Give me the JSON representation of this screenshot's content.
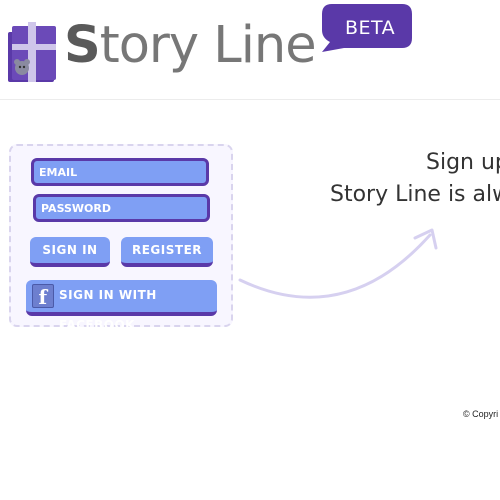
{
  "header": {
    "logo_icon": "storybook-bear-icon",
    "logo_first_letter": "S",
    "logo_rest": "tory Line",
    "beta_label": "BETA"
  },
  "login": {
    "email_placeholder": "EMAIL",
    "password_placeholder": "PASSWORD",
    "sign_in_label": "SIGN IN",
    "register_label": "REGISTER",
    "facebook_label": "SIGN IN WITH FACEBOOK",
    "facebook_icon": "f"
  },
  "promo": {
    "line1": "Sign up",
    "line2": "Story Line is alw"
  },
  "footer": {
    "copyright": "© Copyri"
  },
  "colors": {
    "brand_purple": "#5a39a8",
    "button_blue": "#7f9ff4",
    "logo_grey": "#777777"
  }
}
